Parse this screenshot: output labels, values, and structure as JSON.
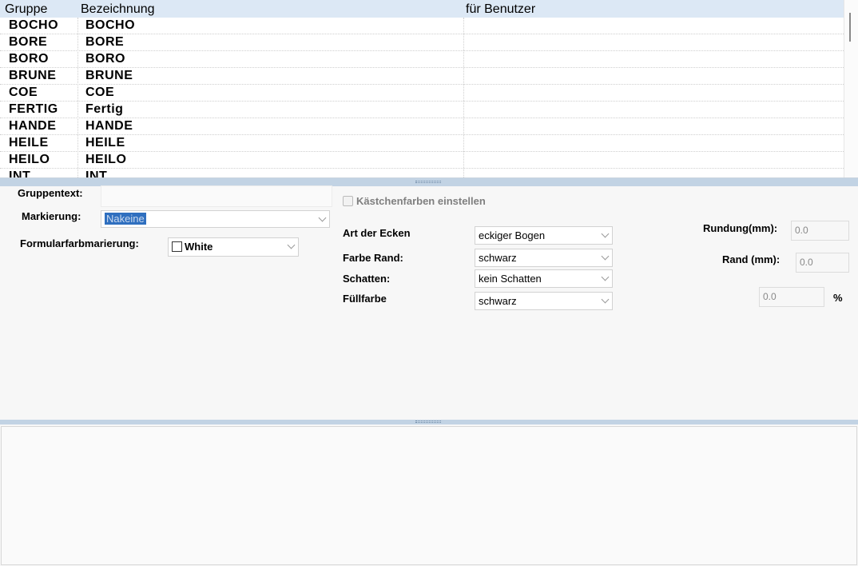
{
  "grid": {
    "columns": [
      "Gruppe",
      "Bezeichnung",
      "für Benutzer"
    ],
    "rows": [
      [
        "BOCHO",
        "BOCHO",
        ""
      ],
      [
        "BORE",
        "BORE",
        ""
      ],
      [
        "BORO",
        "BORO",
        ""
      ],
      [
        "BRUNE",
        "BRUNE",
        ""
      ],
      [
        "COE",
        "COE",
        ""
      ],
      [
        "FERTIG",
        "Fertig",
        ""
      ],
      [
        "HANDE",
        "HANDE",
        ""
      ],
      [
        "HEILE",
        "HEILE",
        ""
      ],
      [
        "HEILO",
        "HEILO",
        ""
      ],
      [
        "INT",
        "INT",
        ""
      ]
    ]
  },
  "form": {
    "gruppentext_label": "Gruppentext:",
    "gruppentext_value": "",
    "markierung_label": "Markierung:",
    "markierung_value": "Nakeine",
    "formularfarb_label": "Formularfarbmarierung:",
    "formularfarb_value": "White",
    "kaestchen_label": "Kästchenfarben einstellen",
    "kaestchen_checked": false,
    "art_ecken_label": "Art der Ecken",
    "art_ecken_value": "eckiger Bogen",
    "farbe_rand_label": "Farbe Rand:",
    "farbe_rand_value": "schwarz",
    "schatten_label": "Schatten:",
    "schatten_value": "kein Schatten",
    "fuellfarbe_label": "Füllfarbe",
    "fuellfarbe_value": "schwarz",
    "rundung_label": "Rundung(mm):",
    "rundung_value": "0.0",
    "rand_label": "Rand (mm):",
    "rand_value": "0.0",
    "percent_value": "0.0",
    "percent_unit": "%"
  },
  "colors": {
    "header_bg": "#dce8f5",
    "splitter": "#c2d3e4",
    "selection": "#2f6fbf"
  }
}
